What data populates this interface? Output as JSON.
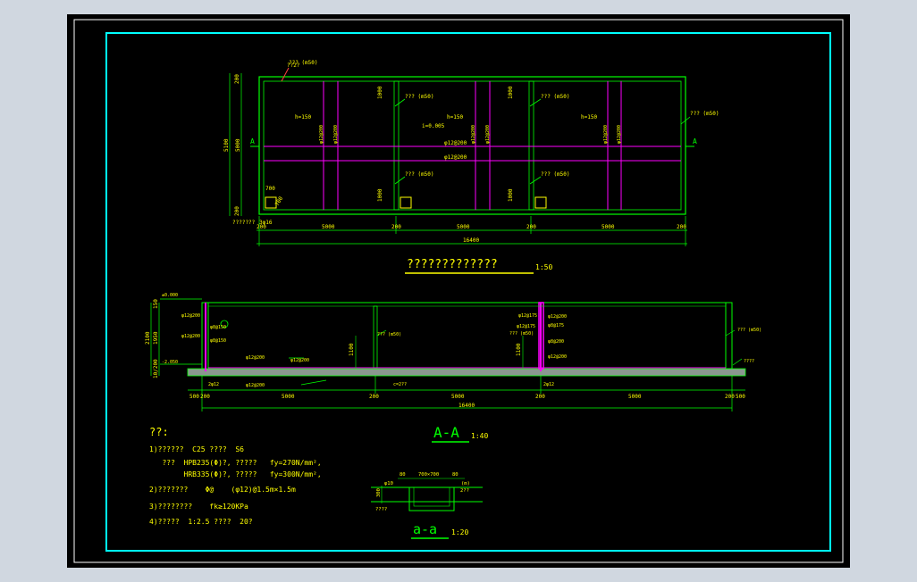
{
  "colors": {
    "background": "#000000",
    "screen_bg": "#d0d7e0",
    "border_white": "#ffffff",
    "border_cyan": "#00ffff",
    "structure_green": "#00ff00",
    "text_yellow": "#ffff00",
    "rebar_magenta": "#ff00ff",
    "slab_fill": "#8a9890",
    "marker_red": "#ff4040"
  },
  "plan": {
    "title": "?????????????",
    "scale": "1:50",
    "section_mark": "A",
    "dim_top_left": "200",
    "dim_height_total": "5100",
    "dim_height_inner": "5000",
    "dim_bottom_left": "200",
    "dims_bottom": [
      "200",
      "5000",
      "200",
      "5000",
      "200",
      "5000",
      "200"
    ],
    "dim_total": "16400",
    "h_labels": [
      "h=150",
      "h=150",
      "h=150"
    ],
    "dims_vertical": [
      "1000",
      "1000",
      "1000",
      "1000"
    ],
    "rebar_center_1": "φ12@200",
    "rebar_center_2": "φ12@200",
    "rebar_vert": [
      "φ12@200",
      "φ12@200",
      "φ12@200",
      "φ12@200",
      "φ12@200",
      "φ12@200"
    ],
    "slope": "i=0.005",
    "outlet_dims": [
      "700",
      "700"
    ],
    "callouts": [
      "??? (m50)",
      "??? (m50)",
      "??? (m50)",
      "??? (m50)",
      "??? (m50)",
      "??? (m50)"
    ],
    "small_tags": [
      "??2?",
      "???????",
      "3φ16"
    ]
  },
  "section": {
    "title": "A-A",
    "scale": "1:40",
    "elev_top": "±0.000",
    "elev_bottom": "-2.050",
    "dims_left": [
      "150",
      "1950",
      "2100",
      "10/200"
    ],
    "dims_bottom": [
      "500",
      "200",
      "5000",
      "200",
      "5000",
      "200",
      "5000",
      "200",
      "500"
    ],
    "dim_total": "16400",
    "dims_inner": [
      "1100",
      "1100"
    ],
    "rebar_labels": [
      "φ12@200",
      "φ8@150",
      "φ12@200",
      "φ8@150",
      "φ12@200",
      "φ12@200",
      "φ12@175",
      "φ12@175",
      "φ8@200",
      "φ12@200",
      "φ8@175",
      "φ12@200",
      "φ12@200"
    ],
    "callouts": [
      "??? (m50)",
      "??? (m50)",
      "??? (m50)",
      "????"
    ],
    "base_labels": [
      "2φ12",
      "2φ12",
      "c=2??"
    ]
  },
  "detail": {
    "title": "a-a",
    "scale": "1:20",
    "dims_top": [
      "80",
      "700×700",
      "80"
    ],
    "label_left": "φ10",
    "label_right": "(m)",
    "label_side": "2??",
    "label_bottom": "????",
    "dim_side": "300"
  },
  "notes": {
    "heading": "??:",
    "lines": [
      "1)??????  C25 ????  S6",
      "   ???  HPB235(Φ)?, ?????   fy=270N/mm²,",
      "        HRB335(Φ)?, ?????   fy=300N/mm²,",
      "2)???????    Φ@    (φ12)@1.5m×1.5m",
      "3)????????    fk≥120KPa",
      "4)?????  1:2.5 ????  20?"
    ]
  }
}
